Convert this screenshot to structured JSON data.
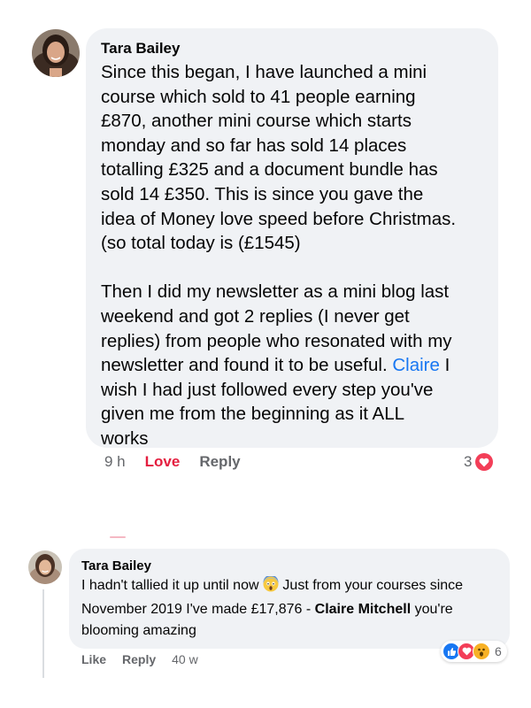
{
  "comments": [
    {
      "author": "Tara Bailey",
      "paragraph1_lines": [
        "Since this began, I have launched a mini",
        "course which sold to 41 people earning",
        "£870, another mini course which starts",
        "monday and so far has sold 14 places",
        "totalling £325 and a document bundle has",
        "sold 14 £350. This is since you gave the",
        "idea of Money love speed before Christmas.",
        "(so total today is (£1545)"
      ],
      "paragraph2_lines": [
        "Then I did my newsletter as a mini blog last",
        "weekend and got 2 replies (I never get",
        "replies) from people who resonated with my",
        "newsletter and found it to be useful."
      ],
      "mention": "Claire",
      "after_mention": " I",
      "paragraph2_tail_lines": [
        "wish I had just followed every step you've",
        "given me from the beginning as it ALL",
        "works"
      ],
      "time": "9 h",
      "love_label": "Love",
      "reply_label": "Reply",
      "reaction_count": "3",
      "reaction_icon": "heart-reaction-icon"
    },
    {
      "author": "Tara Bailey",
      "text_before_emoji": "I hadn't tallied it up until now ",
      "emoji": "scream-emoji-icon",
      "text_after_emoji": " Just from your courses since November 2019 I've made £17,876 - ",
      "mention": "Claire Mitchell",
      "text_end": " you're blooming amazing",
      "like_label": "Like",
      "reply_label": "Reply",
      "time": "40 w",
      "reaction_count": "6",
      "reaction_icons": [
        "like-reaction-icon",
        "love-reaction-icon",
        "wow-reaction-icon"
      ]
    }
  ],
  "colors": {
    "bubble": "#f0f2f5",
    "mention": "#1877f2",
    "love": "#e41e3f",
    "meta": "#65676b"
  }
}
